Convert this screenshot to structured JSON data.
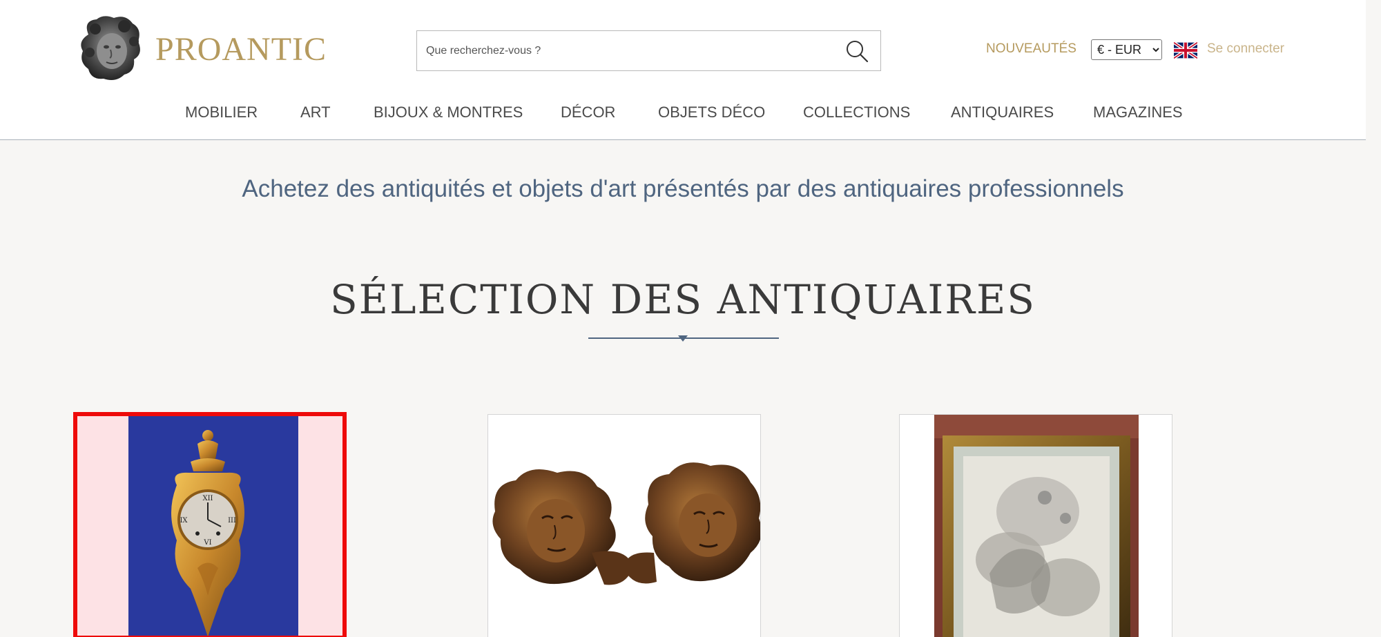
{
  "header": {
    "brand": "PROANTIC",
    "search_placeholder": "Que recherchez-vous ?",
    "nouveautes": "NOUVEAUTÉS",
    "currency": "€ - EUR",
    "currency_options": [
      "€ - EUR"
    ],
    "login": "Se connecter"
  },
  "menu": [
    "MOBILIER",
    "ART",
    "BIJOUX & MONTRES",
    "DÉCOR",
    "OBJETS DÉCO",
    "COLLECTIONS",
    "ANTIQUAIRES",
    "MAGAZINES"
  ],
  "tagline": "Achetez des antiquités et objets d'art présentés par des antiquaires professionnels",
  "section_title": "SÉLECTION DES ANTIQUAIRES",
  "products": [
    {
      "name": "gilt-cartel-clock",
      "selected": true
    },
    {
      "name": "carved-wood-cherub-heads",
      "selected": false
    },
    {
      "name": "framed-mythological-drawing",
      "selected": false
    }
  ],
  "colors": {
    "brand_gold": "#b59a5e",
    "tagline_blue": "#4f6580",
    "selection_red": "#ee0a0a"
  },
  "icons": [
    "cherub-logo-icon",
    "search-icon",
    "uk-flag-icon"
  ]
}
